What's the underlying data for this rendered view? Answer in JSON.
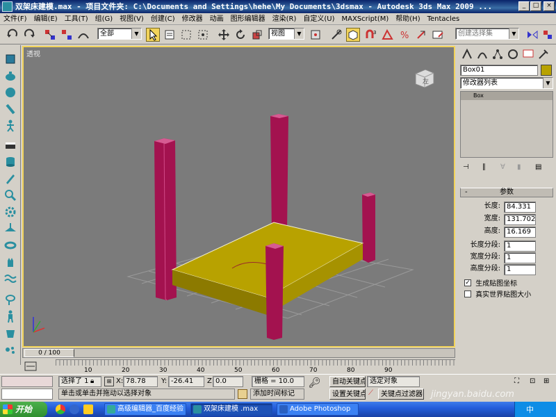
{
  "window": {
    "title": "双架床建模.max   - 项目文件夹: C:\\Documents and Settings\\hehe\\My Documents\\3dsmax   - Autodesk 3ds Max  2009  ...",
    "min": "_",
    "max": "□",
    "close": "×"
  },
  "menu": [
    "文件(F)",
    "编辑(E)",
    "工具(T)",
    "组(G)",
    "视图(V)",
    "创建(C)",
    "修改器",
    "动画",
    "图形编辑器",
    "渲染(R)",
    "自定义(U)",
    "MAXScript(M)",
    "帮助(H)",
    "Tentacles"
  ],
  "toolbar": {
    "selection_filter": "全部",
    "ref_coord": "视图",
    "named_selection_placeholder": "创建选择集"
  },
  "viewport": {
    "label": "透视",
    "viewcube_label": "左",
    "colors": {
      "background": "#7b7b7b",
      "border": "#f2d35a",
      "box": "#b8a200",
      "posts": "#a3124f"
    }
  },
  "command_panel": {
    "object_name": "Box01",
    "modifier_list": "修改器列表",
    "stack_item": "Box",
    "rollout_title": "参数",
    "params": [
      {
        "label": "长度:",
        "value": "84.331"
      },
      {
        "label": "宽度:",
        "value": "131.702"
      },
      {
        "label": "高度:",
        "value": "16.169"
      }
    ],
    "segments": [
      {
        "label": "长度分段:",
        "value": "1"
      },
      {
        "label": "宽度分段:",
        "value": "1"
      },
      {
        "label": "高度分段:",
        "value": "1"
      }
    ],
    "checkboxes": [
      {
        "label": "生成贴图坐标",
        "checked": true
      },
      {
        "label": "真实世界贴图大小",
        "checked": false
      }
    ]
  },
  "timeline": {
    "frame": "0 / 100",
    "ticks": [
      "10",
      "20",
      "30",
      "40",
      "50",
      "60",
      "70",
      "80",
      "90"
    ]
  },
  "status": {
    "selected": "选择了 1",
    "x_label": "X:",
    "x_value": "78.78",
    "y_label": "Y:",
    "y_value": "-26.41",
    "z_label": "Z:",
    "z_value": "0.0",
    "grid": "栅格 = 10.0",
    "autokey": "自动关键点",
    "selected_object": "选定对象",
    "setkey": "设置关键点",
    "key_filters": "关键点过滤器...",
    "prompt": "单击或单击并拖动以选择对象",
    "add_time_tag": "添加时间标记"
  },
  "taskbar": {
    "start": "开始",
    "tasks": [
      "高级编辑器_百度经验",
      "双架床建模 .max",
      "Adobe Photoshop"
    ],
    "tray_lang": "中"
  },
  "watermark": "jingyan.baidu.com"
}
